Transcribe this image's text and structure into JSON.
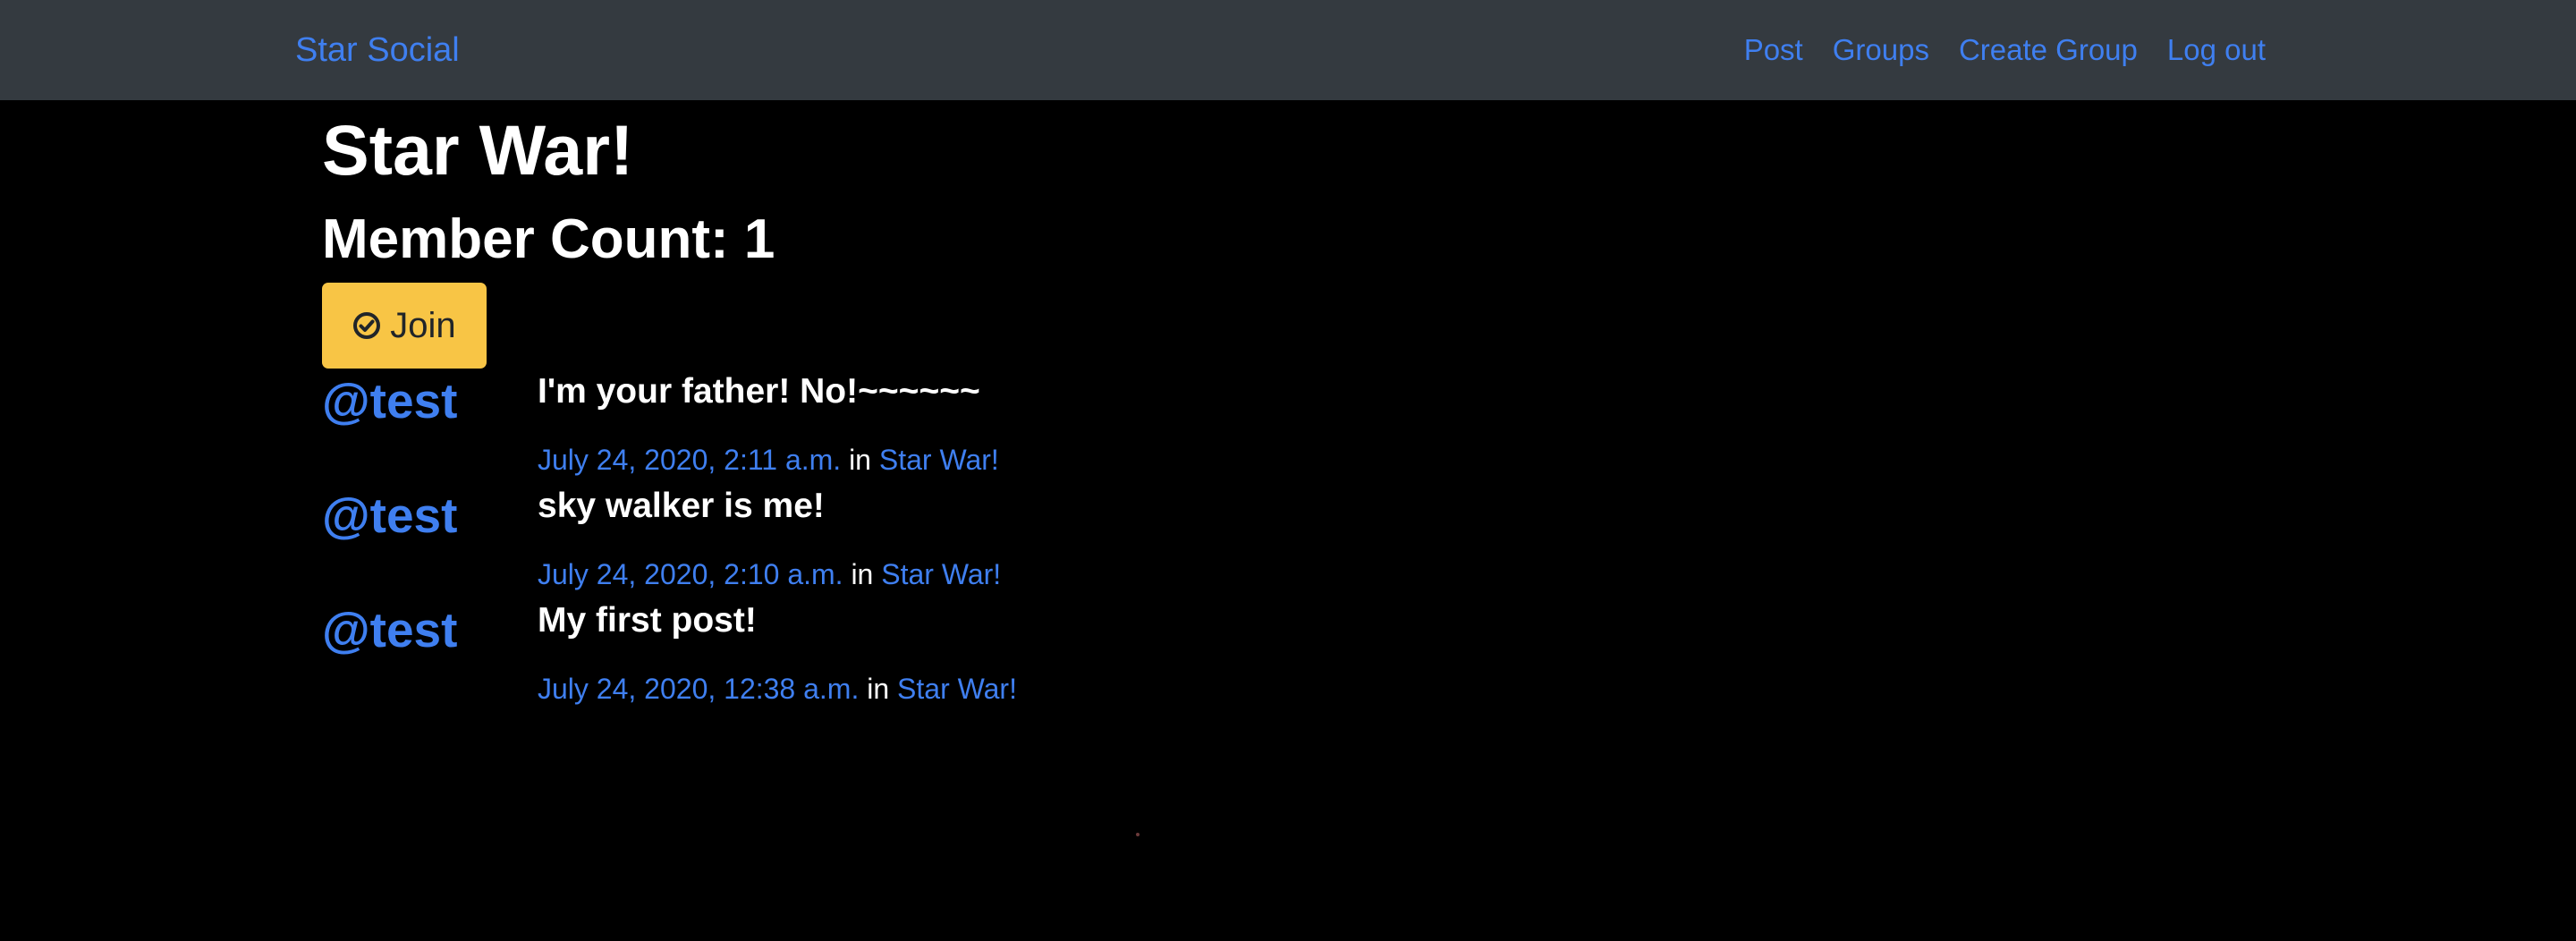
{
  "navbar": {
    "brand": "Star Social",
    "links": [
      "Post",
      "Groups",
      "Create Group",
      "Log out"
    ]
  },
  "group": {
    "title": "Star War!",
    "member_count": "Member Count: 1",
    "join_label": "Join",
    "join_icon": "check-circle-icon",
    "join_color": "#f8c545"
  },
  "posts": [
    {
      "user": "@test",
      "message": "I'm your father! No!~~~~~~",
      "timestamp": "July 24, 2020, 2:11 a.m.",
      "in_text": "in",
      "group": "Star War!"
    },
    {
      "user": "@test",
      "message": "sky walker is me!",
      "timestamp": "July 24, 2020, 2:10 a.m.",
      "in_text": "in",
      "group": "Star War!"
    },
    {
      "user": "@test",
      "message": "My first post!",
      "timestamp": "July 24, 2020, 12:38 a.m.",
      "in_text": "in",
      "group": "Star War!"
    }
  ],
  "colors": {
    "background": "#000000",
    "navbar": "#343a40",
    "link": "#3f7ff0",
    "text": "#ffffff"
  }
}
